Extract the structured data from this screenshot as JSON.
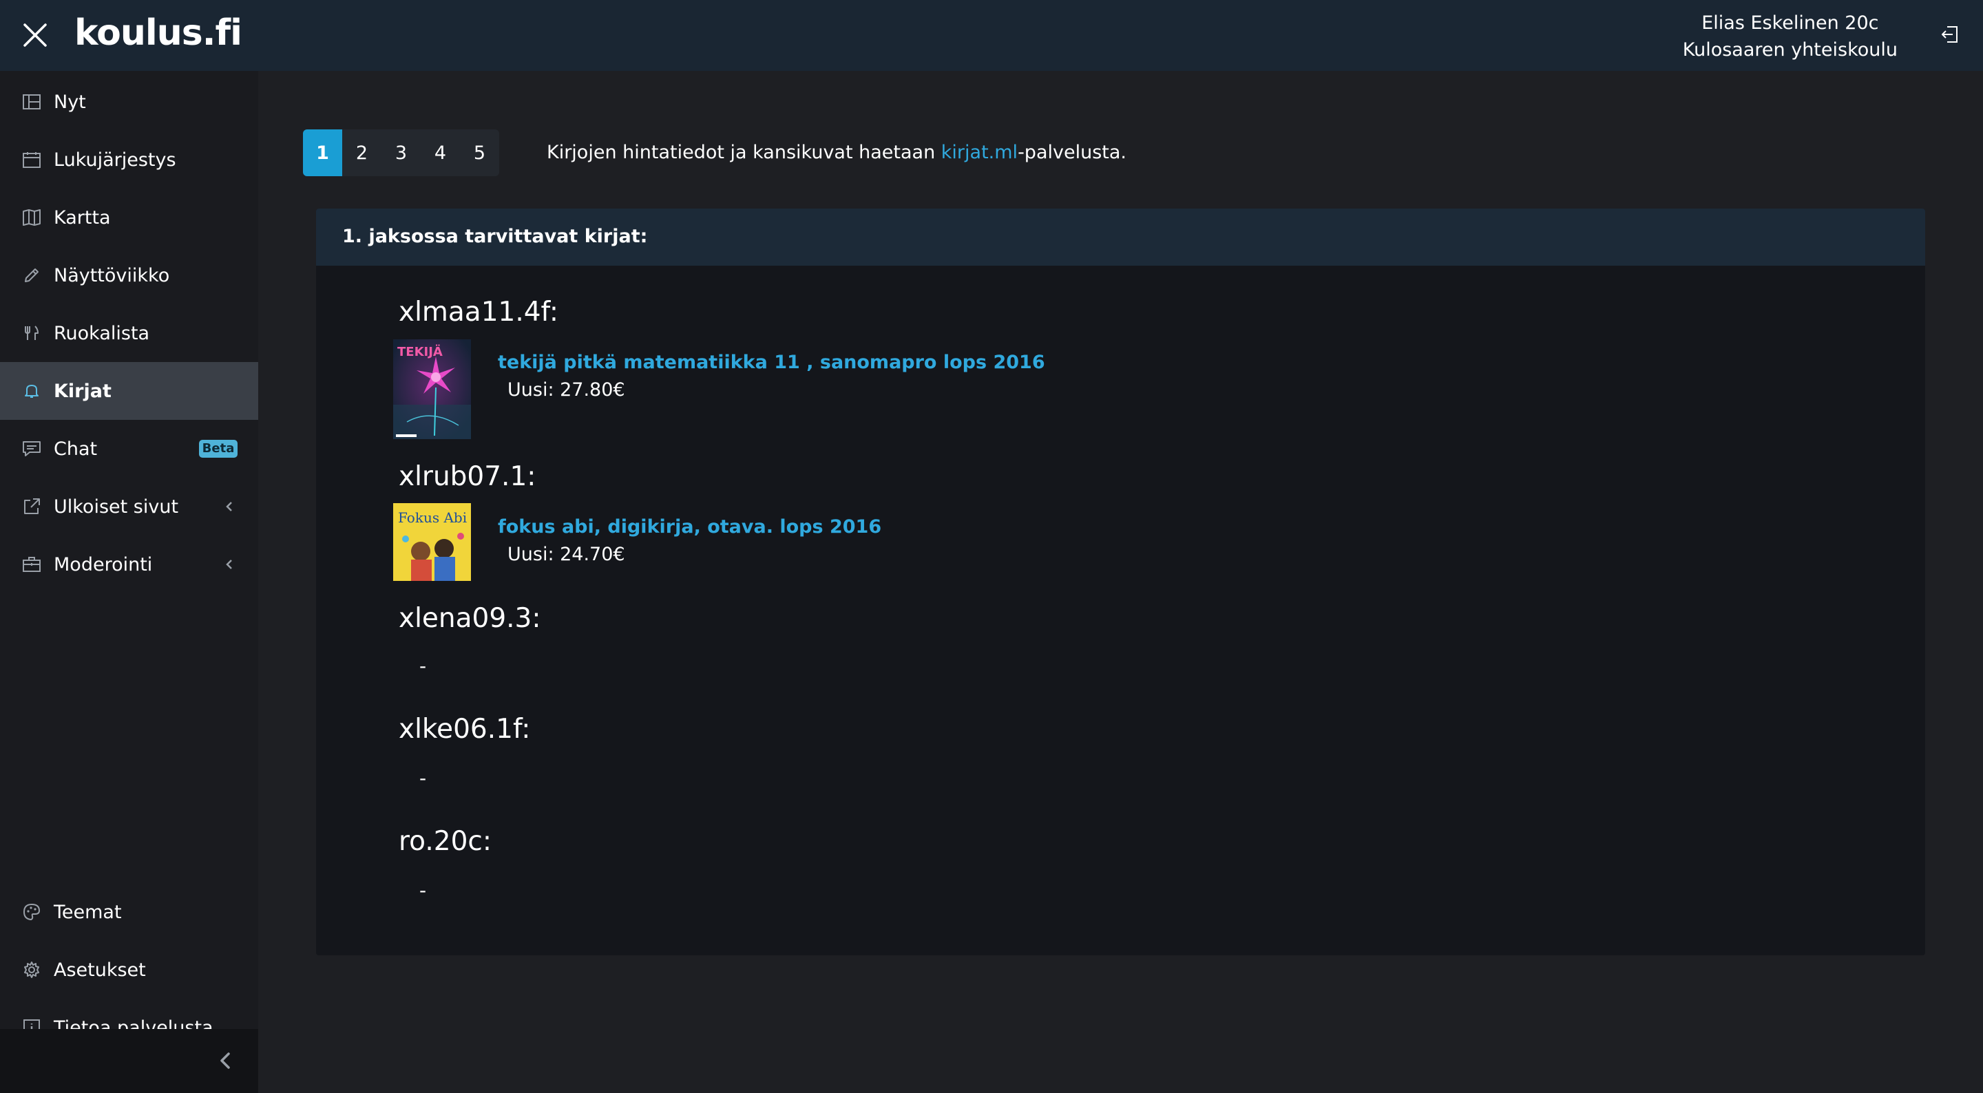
{
  "header": {
    "logo": "koulus.fi",
    "user_name": "Elias Eskelinen 20c",
    "school": "Kulosaaren yhteiskoulu"
  },
  "sidebar": {
    "items": [
      {
        "label": "Nyt",
        "icon": "dashboard-icon"
      },
      {
        "label": "Lukujärjestys",
        "icon": "calendar-icon"
      },
      {
        "label": "Kartta",
        "icon": "map-icon"
      },
      {
        "label": "Näyttöviikko",
        "icon": "pencil-icon"
      },
      {
        "label": "Ruokalista",
        "icon": "fork-knife-icon"
      },
      {
        "label": "Kirjat",
        "icon": "bell-icon",
        "active": true
      },
      {
        "label": "Chat",
        "icon": "chat-icon",
        "badge": "Beta"
      },
      {
        "label": "Ulkoiset sivut",
        "icon": "external-link-icon"
      },
      {
        "label": "Moderointi",
        "icon": "briefcase-icon"
      }
    ],
    "bottom_items": [
      {
        "label": "Teemat",
        "icon": "palette-icon"
      },
      {
        "label": "Asetukset",
        "icon": "gear-icon"
      },
      {
        "label": "Tietoa palvelusta",
        "icon": "info-icon"
      }
    ]
  },
  "main": {
    "pages": [
      "1",
      "2",
      "3",
      "4",
      "5"
    ],
    "active_page": "1",
    "info_prefix": "Kirjojen hintatiedot ja kansikuvat haetaan ",
    "info_link": "kirjat.ml",
    "info_suffix": "-palvelusta.",
    "panel_title": "1. jaksossa tarvittavat kirjat:",
    "courses": [
      {
        "code": "xlmaa11.4f:",
        "book": {
          "title": "tekijä pitkä matematiikka 11 , sanomapro lops 2016",
          "price": "Uusi: 27.80€",
          "cover_text": "TEKIJÄ"
        }
      },
      {
        "code": "xlrub07.1:",
        "book": {
          "title": "fokus abi, digikirja, otava. lops 2016",
          "price": "Uusi: 24.70€",
          "cover_text": "Fokus Abi"
        }
      },
      {
        "code": "xlena09.3:",
        "empty": "-"
      },
      {
        "code": "xlke06.1f:",
        "empty": "-"
      },
      {
        "code": "ro.20c:",
        "empty": "-"
      }
    ]
  },
  "colors": {
    "accent": "#1a9ed4",
    "link": "#30a9de",
    "header_bg": "#1a2633",
    "sidebar_bg": "#1a1b1f",
    "active_item": "#3a3f47"
  }
}
